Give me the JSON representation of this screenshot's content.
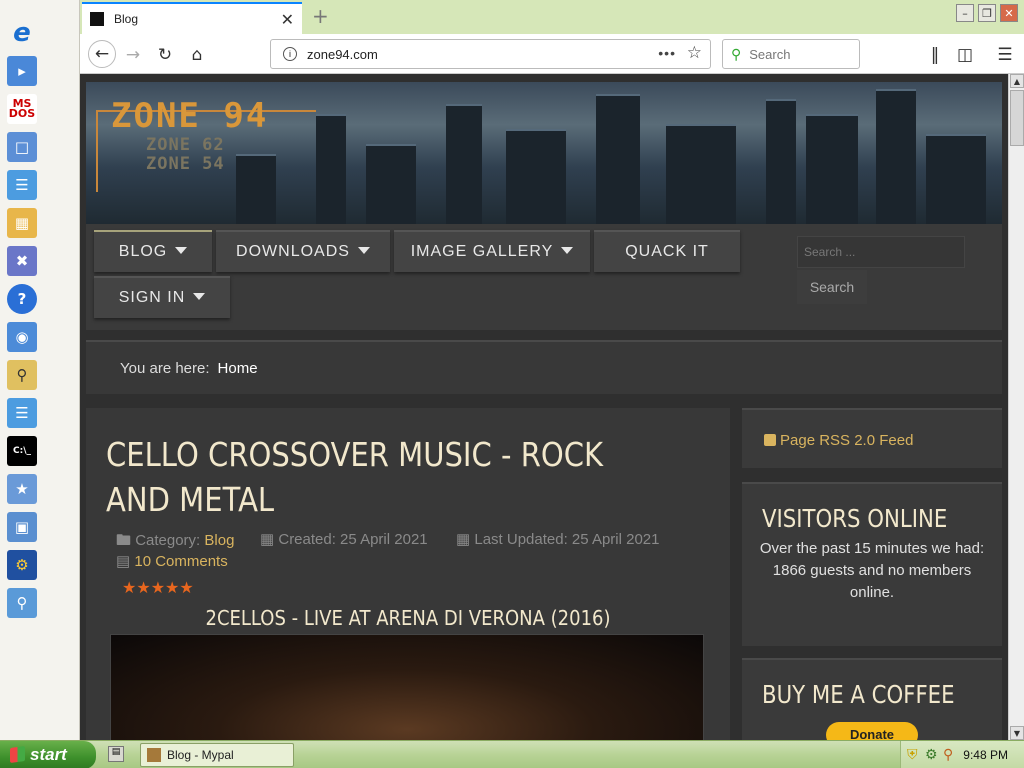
{
  "quicklaunch": {
    "icons": [
      "internet-explorer-icon",
      "app-icon",
      "ms-dos-icon",
      "computer-icon",
      "notepad-icon",
      "control-panel-icon",
      "tools-icon",
      "help-icon",
      "network-icon",
      "search-icon",
      "notes-icon",
      "command-prompt-icon",
      "network-wizard-icon",
      "monitor-icon",
      "settings-icon",
      "magnifier-icon"
    ]
  },
  "browser": {
    "tab_title": "Blog",
    "new_tab": "+",
    "url": "zone94.com",
    "search_placeholder": "Search"
  },
  "site": {
    "logo": "ZONE 94",
    "logo_sub1": "ZONE 62",
    "logo_sub2": "ZONE 54",
    "menu": [
      {
        "label": "BLOG",
        "dropdown": true,
        "active": true
      },
      {
        "label": "DOWNLOADS",
        "dropdown": true
      },
      {
        "label": "IMAGE GALLERY",
        "dropdown": true
      },
      {
        "label": "QUACK IT",
        "dropdown": false
      },
      {
        "label": "SIGN IN",
        "dropdown": true
      }
    ],
    "search_placeholder": "Search ...",
    "search_button": "Search",
    "breadcrumb_label": "You are here:",
    "breadcrumb_home": "Home"
  },
  "article": {
    "title": "CELLO CROSSOVER MUSIC - ROCK AND METAL",
    "category_label": "Category:",
    "category": "Blog",
    "created": "Created: 25 April 2021",
    "updated": "Last Updated: 25 April 2021",
    "comments": "10 Comments",
    "rating_stars": 5,
    "subtitle": "2CELLOS - LIVE AT ARENA DI VERONA (2016)"
  },
  "sidebar": {
    "rss": "Page RSS 2.0 Feed",
    "visitors_title": "VISITORS ONLINE",
    "visitors_text": "Over the past 15 minutes we had:",
    "visitors_count": "1866 guests and no members online.",
    "coffee_title": "BUY ME A COFFEE",
    "donate": "Donate"
  },
  "taskbar": {
    "start": "start",
    "task": "Blog - Mypal",
    "clock": "9:48 PM"
  },
  "colors": {
    "page_bg": "#2f2f2f",
    "accent_gold": "#d9b45f",
    "title_cream": "#f2e8cc",
    "star_orange": "#e8661e",
    "donate_yellow": "#f5b817"
  }
}
